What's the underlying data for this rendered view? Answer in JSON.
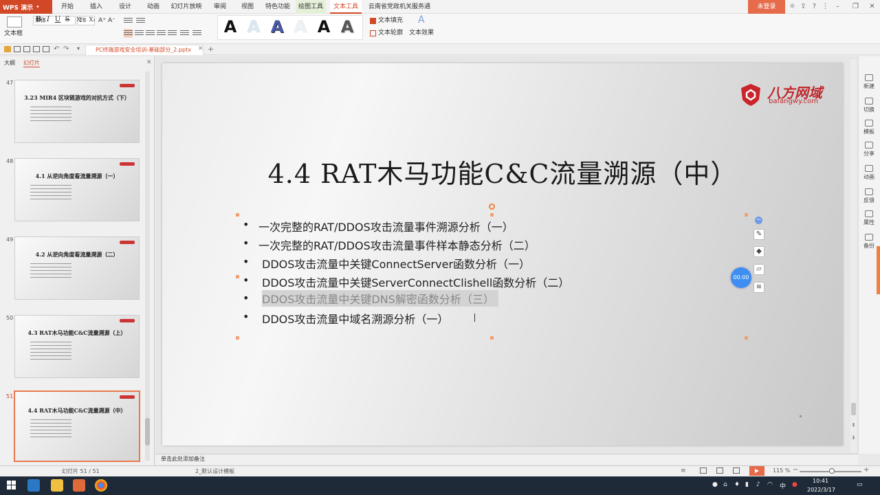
{
  "app": {
    "name": "WPS 演示"
  },
  "menu": {
    "items": [
      "开始",
      "插入",
      "设计",
      "动画",
      "幻灯片放映",
      "审阅",
      "视图",
      "特色功能",
      "绘图工具",
      "文本工具",
      "云南省党政机关服务通道"
    ],
    "login": "未登录"
  },
  "ribbon": {
    "textbox": "文本框",
    "font_name": "宋体",
    "font_size": "18",
    "grow": "A⁺",
    "shrink": "A⁻",
    "bold": "B",
    "italic": "I",
    "underline": "U",
    "strike": "S",
    "super": "X²",
    "sub": "X₂",
    "text_fill": "文本填充",
    "text_outline": "文本轮廓",
    "text_effect": "文本效果",
    "wordart_glyph": "A"
  },
  "document_tab": {
    "title": "PC终端游戏安全培训-基础部分_2.pptx"
  },
  "left_panel": {
    "tabs": [
      "大纲",
      "幻灯片"
    ],
    "slides": [
      {
        "num": "47",
        "title": "3.23 MIR4 区块链游戏的对抗方式（下）"
      },
      {
        "num": "48",
        "title": "4.1 从逆向角度看流量溯源（一）"
      },
      {
        "num": "49",
        "title": "4.2 从逆向角度看流量溯源（二）"
      },
      {
        "num": "50",
        "title": "4.3 RAT木马功能C&C流量溯源（上）"
      },
      {
        "num": "51",
        "title": "4.4 RAT木马功能C&C流量溯源（中）"
      }
    ]
  },
  "slide": {
    "title": "4.4 RAT木马功能C&C流量溯源（中）",
    "logo_name": "八方网域",
    "logo_url": "bafangwy.com",
    "bullets": [
      "一次完整的RAT/DDOS攻击流量事件溯源分析（一）",
      "一次完整的RAT/DDOS攻击流量事件样本静态分析（二）",
      "DDOS攻击流量中关键ConnectServer函数分析（一）",
      "DDOS攻击流量中关键ServerConnectClishell函数分析（二）",
      "DDOS攻击流量中关键DNS解密函数分析（三）",
      "DDOS攻击流量中域名溯源分析（一）"
    ],
    "bullet_glyph": "•",
    "timer": "00:00"
  },
  "right_sidebar": {
    "items": [
      "新建",
      "切换",
      "模板",
      "分享",
      "动画",
      "反馈",
      "属性",
      "备份"
    ]
  },
  "notes": {
    "placeholder": "单击此处添加备注"
  },
  "status": {
    "slide_counter": "幻灯片 51 / 51",
    "template": "2_默认设计模板",
    "zoom": "115 %"
  },
  "taskbar": {
    "time": "10:41",
    "date": "2022/3/17",
    "ime": "中"
  }
}
